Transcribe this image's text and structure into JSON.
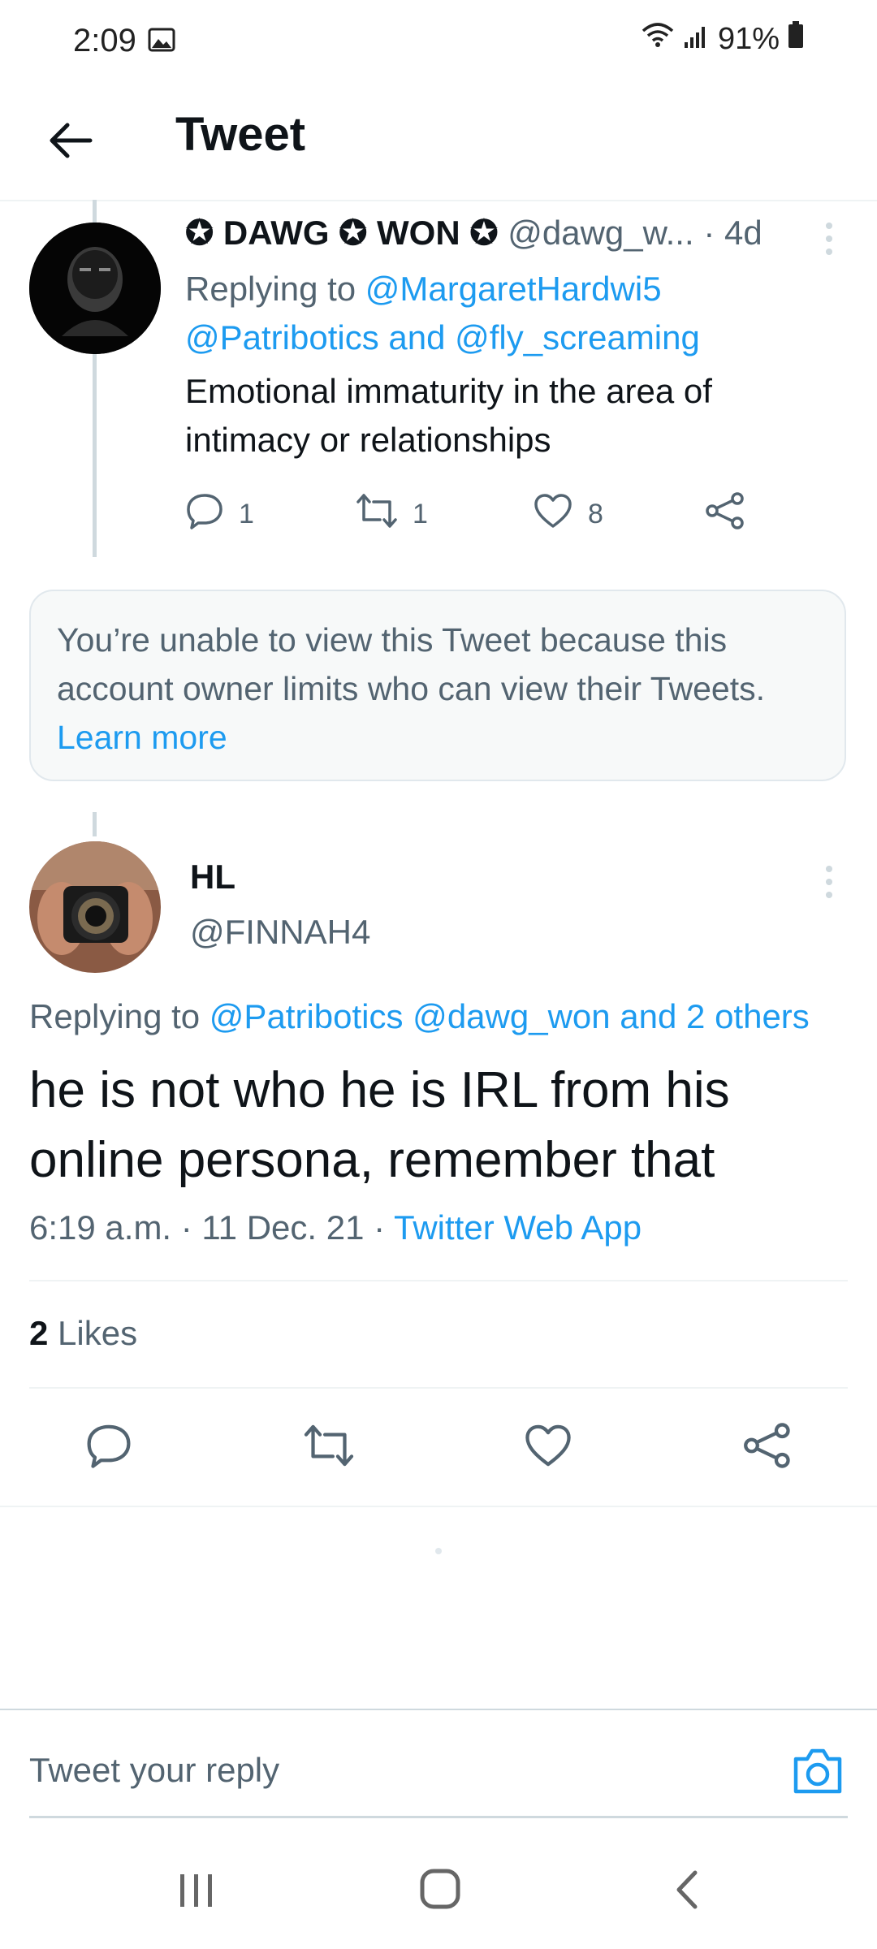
{
  "status_bar": {
    "time": "2:09",
    "battery": "91%"
  },
  "header": {
    "title": "Tweet"
  },
  "tweet1": {
    "name": "✪ DAWG ✪ WON ✪",
    "handle": "@dawg_w...",
    "age": "· 4d",
    "replying_prefix": "Replying to",
    "replying_line1": "@MargaretHardwi5",
    "replying_line2": "@Patribotics and @fly_screaming",
    "text_line1": "Emotional immaturity in the area of",
    "text_line2": "intimacy or relationships",
    "replies": "1",
    "retweets": "1",
    "likes": "8"
  },
  "notice": {
    "text": "You’re unable to view this Tweet because this account owner limits who can view their Tweets.",
    "link": "Learn more"
  },
  "main_tweet": {
    "name": "HL",
    "handle": "@FINNAH4",
    "replying_prefix": "Replying to",
    "replying_to": "@Patribotics @dawg_won and 2 others",
    "text_line1": "he is not who he is IRL from his",
    "text_line2": "online persona, remember that",
    "timestamp": "6:19 a.m. · 11 Dec. 21 ·",
    "source": "Twitter Web App",
    "likes_count": "2",
    "likes_label": "Likes"
  },
  "reply": {
    "placeholder": "Tweet your reply"
  },
  "colors": {
    "accent": "#1d9bf0",
    "secondary_text": "#536471",
    "divider": "#eff3f4"
  }
}
